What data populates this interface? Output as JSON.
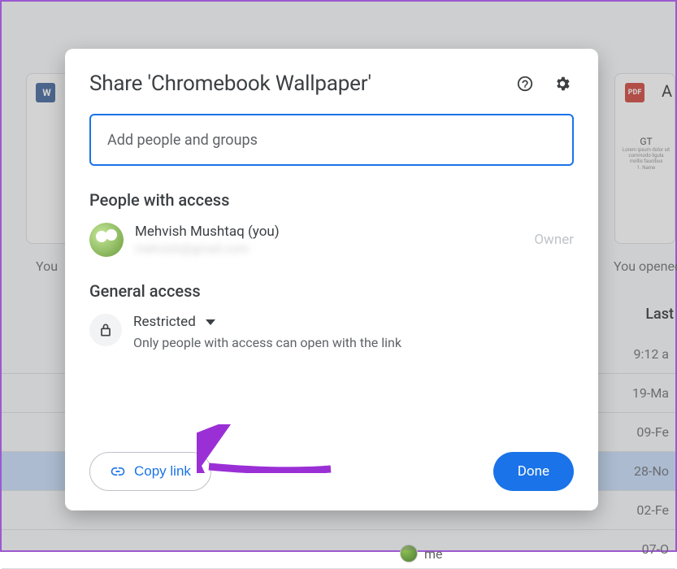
{
  "dialog": {
    "title": "Share 'Chromebook Wallpaper'",
    "input_placeholder": "Add people and groups",
    "people_heading": "People with access",
    "person": {
      "name": "Mehvish Mushtaq (you)",
      "email": "mehvish@gmail.com",
      "role": "Owner"
    },
    "general_heading": "General access",
    "access_level": "Restricted",
    "access_desc": "Only people with access can open with the link",
    "copy_link": "Copy link",
    "done": "Done"
  },
  "background": {
    "word_label": "W",
    "pdf_label": "PDF",
    "a_label": "A",
    "gt_title": "GT",
    "you_left": "You",
    "you_right": "You opened",
    "last_header": "Last",
    "me_label": "me",
    "times": [
      "9:12 a",
      "19-Ma",
      "09-Fe",
      "28-No",
      "02-Fe",
      "07-O"
    ]
  }
}
